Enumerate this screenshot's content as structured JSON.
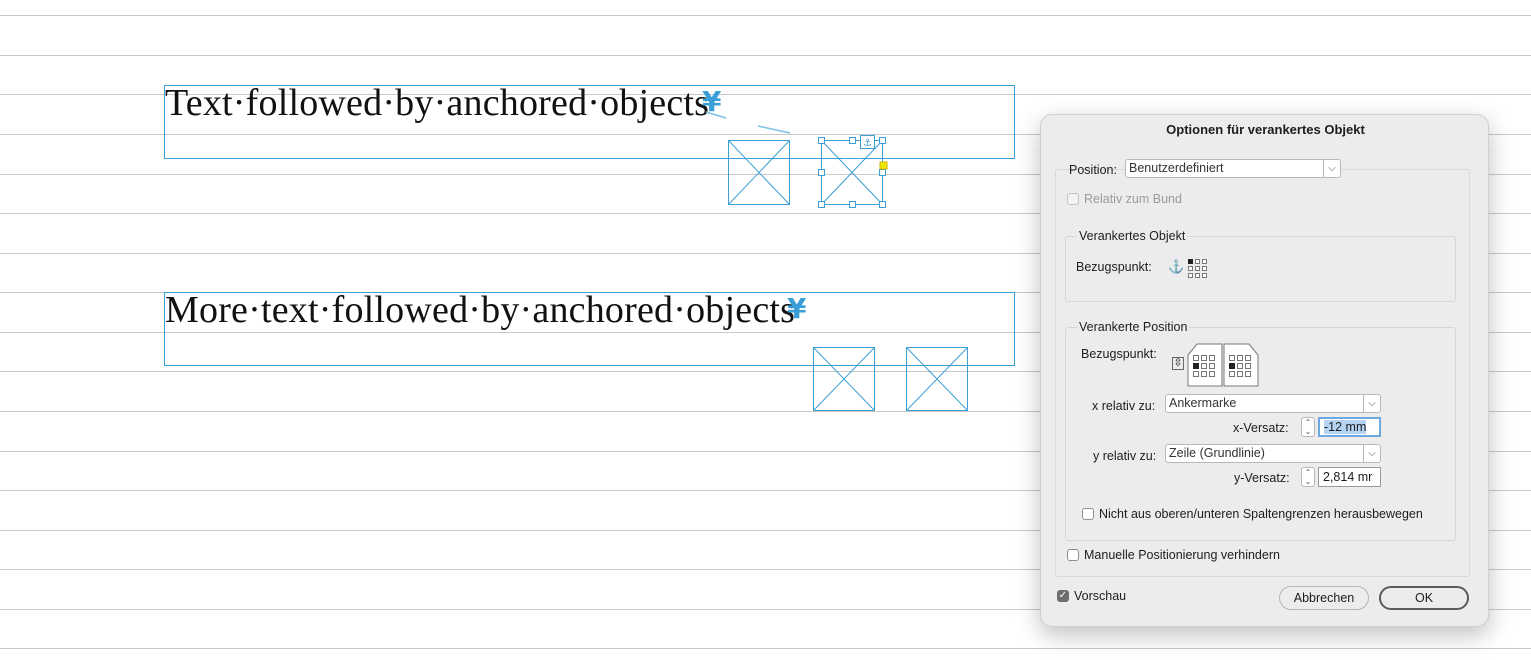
{
  "document": {
    "line1_text": "Text·followed·by·anchored·objects",
    "line2_text": "More·text·followed·by·anchored·objects",
    "anchor_glyph": "¥",
    "frame_color": "#3a9fd6"
  },
  "dialog": {
    "title": "Optionen für verankertes Objekt",
    "position_label": "Position:",
    "position_value": "Benutzerdefiniert",
    "relative_to_spine_label": "Relativ zum Bund",
    "anchored_object_group": "Verankertes Objekt",
    "reference_point_label": "Bezugspunkt:",
    "anchored_position_group": "Verankerte Position",
    "reference_point_label_2": "Bezugspunkt:",
    "x_relative_label": "x relativ zu:",
    "x_relative_value": "Ankermarke",
    "x_offset_label": "x-Versatz:",
    "x_offset_value": "-12 mm",
    "y_relative_label": "y relativ zu:",
    "y_relative_value": "Zeile (Grundlinie)",
    "y_offset_label": "y-Versatz:",
    "y_offset_value": "2,814 mr",
    "keep_within_label": "Nicht aus oberen/unteren Spaltengrenzen herausbewegen",
    "prevent_manual_label": "Manuelle Positionierung verhindern",
    "preview_label": "Vorschau",
    "preview_checked": true,
    "cancel_label": "Abbrechen",
    "ok_label": "OK"
  }
}
